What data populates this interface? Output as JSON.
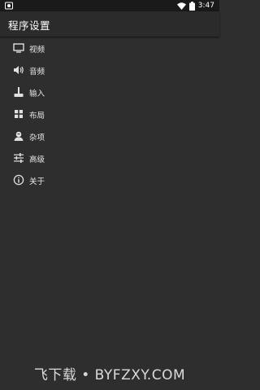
{
  "status_bar": {
    "time": "3:47",
    "left_icon": "screenshot-icon",
    "wifi_icon": "wifi-icon",
    "battery_icon": "battery-icon"
  },
  "app_bar": {
    "title": "程序设置"
  },
  "menu": {
    "items": [
      {
        "label": "视频",
        "icon": "monitor-icon"
      },
      {
        "label": "音频",
        "icon": "speaker-icon"
      },
      {
        "label": "输入",
        "icon": "joystick-icon"
      },
      {
        "label": "布局",
        "icon": "grid-icon"
      },
      {
        "label": "杂项",
        "icon": "person-icon"
      },
      {
        "label": "高级",
        "icon": "sliders-icon"
      },
      {
        "label": "关于",
        "icon": "info-icon"
      }
    ]
  },
  "watermark": {
    "text": "飞下载 • BYFZXY.COM"
  },
  "colors": {
    "background": "#2e2e2e",
    "status_bar": "#1a1a1a",
    "app_bar": "#2b2b2b",
    "text": "#e8e8e8",
    "icon": "#e0e0e0"
  }
}
